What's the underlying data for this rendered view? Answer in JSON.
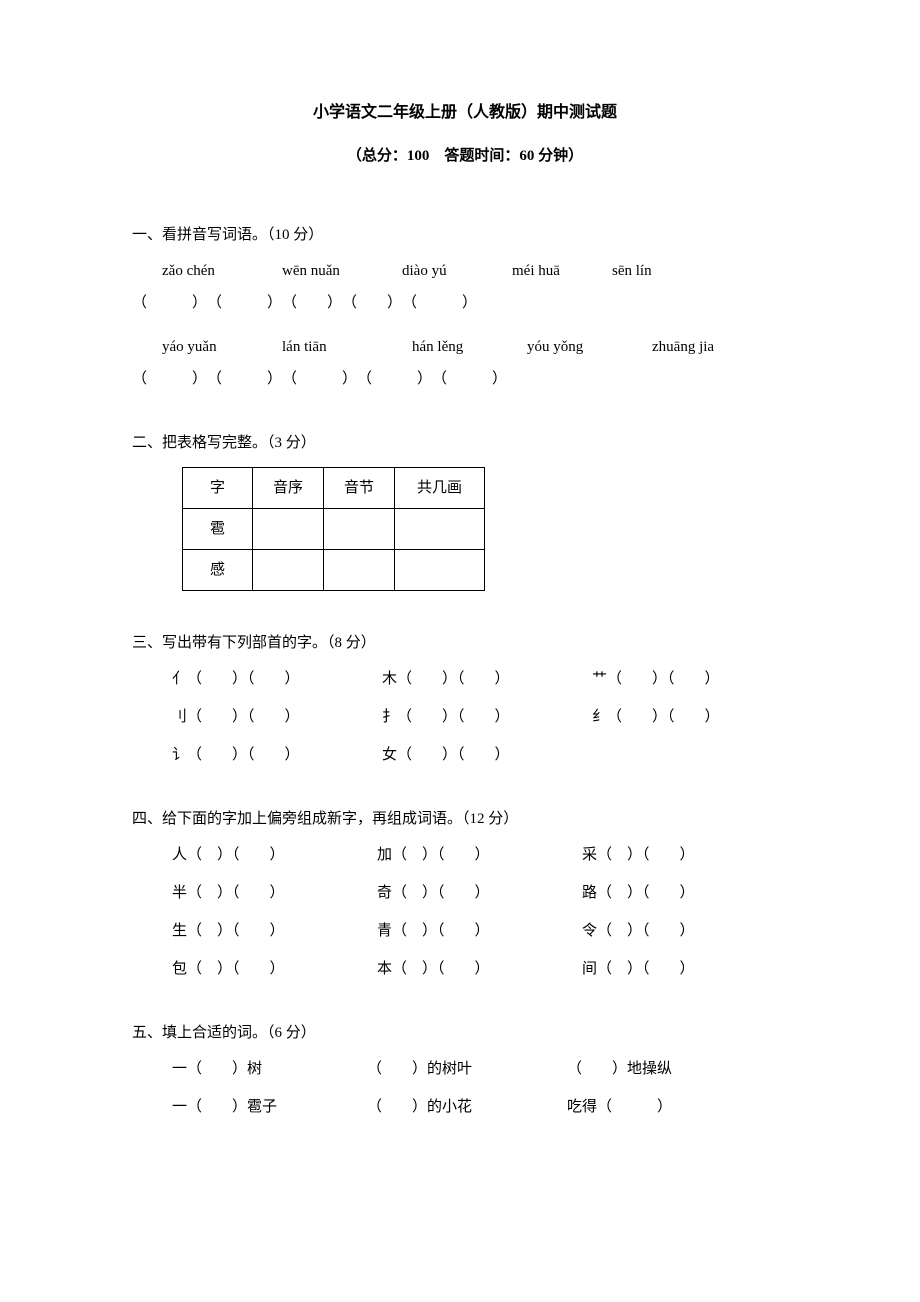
{
  "header": {
    "title": "小学语文二年级上册（人教版）期中测试题",
    "subtitle": "（总分：100　答题时间：60 分钟）"
  },
  "q1": {
    "heading": "一、看拼音写词语。（10 分）",
    "row1": {
      "p1": "zǎo chén",
      "p2": "wēn nuǎn",
      "p3": "diào yú",
      "p4": "méi huā",
      "p5": "sēn lín"
    },
    "blanks1": "（　　　）　（　　　）　（　　）　（　　）　（　　　）",
    "row2": {
      "p1": "yáo yuǎn",
      "p2": "lán tiān",
      "p3": "hán lěng",
      "p4": "yóu yǒng",
      "p5": "zhuāng jia"
    },
    "blanks2": "（　　　）　（　　　）　（　　　）　（　　　）　（　　　）"
  },
  "q2": {
    "heading": "二、把表格写完整。（3 分）",
    "headers": {
      "c1": "字",
      "c2": "音序",
      "c3": "音节",
      "c4": "共几画"
    },
    "r1": "雹",
    "r2": "感"
  },
  "q3": {
    "heading": "三、写出带有下列部首的字。（8 分）",
    "rows": [
      {
        "a": "亻（　　）（　　）",
        "b": "木（　　）（　　）",
        "c": "艹（　　）（　　）"
      },
      {
        "a": "刂（　　）（　　）",
        "b": "扌（　　）（　　）",
        "c": "纟（　　）（　　）"
      },
      {
        "a": "讠（　　）（　　）",
        "b": "女（　　）（　　）",
        "c": ""
      }
    ]
  },
  "q4": {
    "heading": "四、给下面的字加上偏旁组成新字，再组成词语。（12 分）",
    "rows": [
      {
        "a": "人（　）（　　）",
        "b": "加（　）（　　）",
        "c": "采（　）（　　）"
      },
      {
        "a": "半（　）（　　）",
        "b": "奇（　）（　　）",
        "c": "路（　）（　　）"
      },
      {
        "a": "生（　）（　　）",
        "b": "青（　）（　　）",
        "c": "令（　）（　　）"
      },
      {
        "a": "包（　）（　　）",
        "b": "本（　）（　　）",
        "c": "间（　）（　　）"
      }
    ]
  },
  "q5": {
    "heading": "五、填上合适的词。（6 分）",
    "rows": [
      {
        "a": "一（　　）树",
        "b": "（　　）的树叶",
        "c": "（　　）地操纵"
      },
      {
        "a": "一（　　）雹子",
        "b": "（　　）的小花",
        "c": "吃得（　　　）"
      }
    ]
  }
}
